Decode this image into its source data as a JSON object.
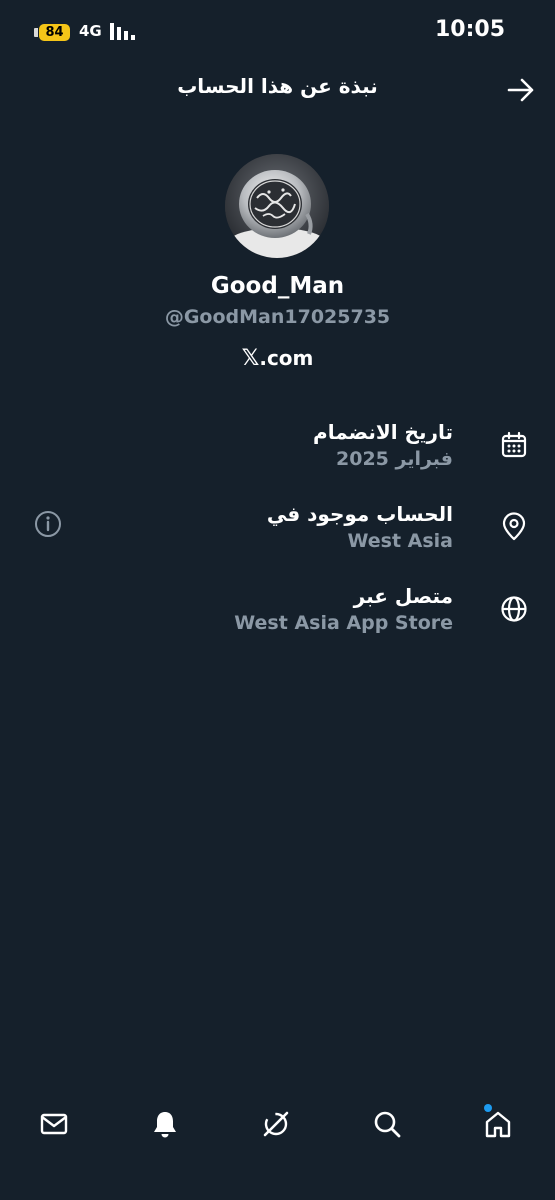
{
  "status_bar": {
    "battery": "84",
    "network": "4G",
    "time": "10:05"
  },
  "header": {
    "title": "نبذة عن هذا الحساب"
  },
  "profile": {
    "display_name": "Good_Man",
    "handle": "@GoodMan17025735",
    "x_mark": "𝕏",
    "site_suffix": ".com"
  },
  "info": {
    "joined_label": "تاريخ الانضمام",
    "joined_value": "فبراير 2025",
    "location_label": "الحساب موجود في",
    "location_value": "West Asia",
    "connected_label": "متصل عبر",
    "connected_value": "West Asia App Store"
  },
  "colors": {
    "background": "#15202b",
    "secondary_text": "#8b98a5",
    "accent": "#1d9bf0",
    "battery": "#f5c518"
  },
  "icons": [
    "back-arrow-icon",
    "calendar-icon",
    "location-pin-icon",
    "globe-icon",
    "info-icon",
    "mail-icon",
    "bell-icon",
    "grok-icon",
    "search-icon",
    "home-icon"
  ]
}
